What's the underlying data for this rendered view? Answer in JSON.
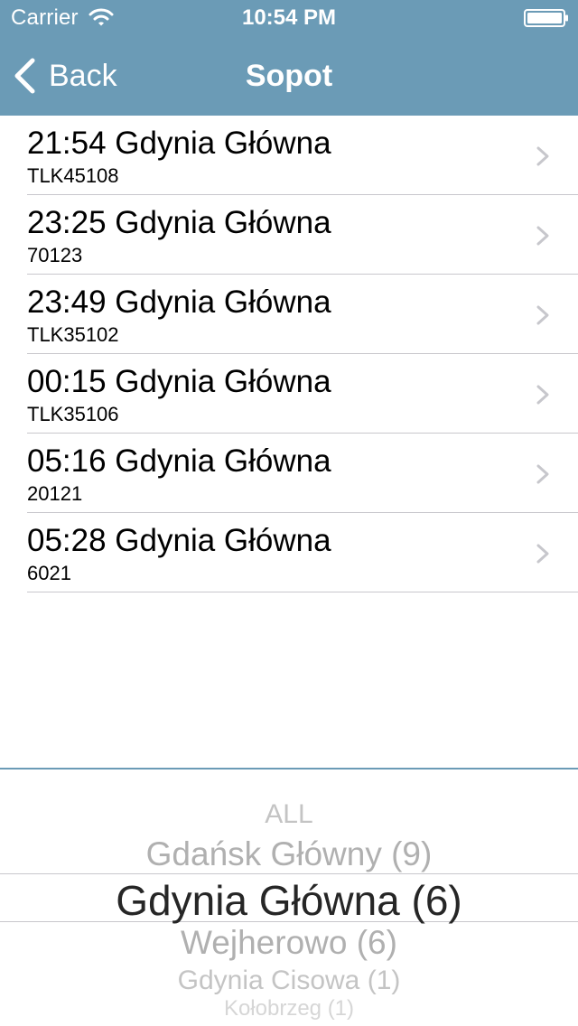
{
  "status_bar": {
    "carrier": "Carrier",
    "time": "10:54 PM"
  },
  "nav": {
    "back_label": "Back",
    "title": "Sopot"
  },
  "colors": {
    "nav_background": "#6b9bb6",
    "nav_text": "#ffffff",
    "chevron": "#c7c7cc",
    "picker_selected_text": "#262626",
    "picker_unselected_text": "#b0b0b0"
  },
  "trains": [
    {
      "main": "21:54 Gdynia Główna",
      "number": "TLK45108"
    },
    {
      "main": "23:25 Gdynia Główna",
      "number": "70123"
    },
    {
      "main": "23:49 Gdynia Główna",
      "number": "TLK35102"
    },
    {
      "main": "00:15 Gdynia Główna",
      "number": "TLK35106"
    },
    {
      "main": "05:16 Gdynia Główna",
      "number": "20121"
    },
    {
      "main": "05:28 Gdynia Główna",
      "number": "6021"
    }
  ],
  "picker": {
    "options": [
      "ALL",
      "Gdańsk Główny (9)",
      "Gdynia Główna (6)",
      "Wejherowo (6)",
      "Gdynia Cisowa (1)",
      "Kołobrzeg (1)"
    ],
    "selected": "Gdynia Główna (6)"
  }
}
